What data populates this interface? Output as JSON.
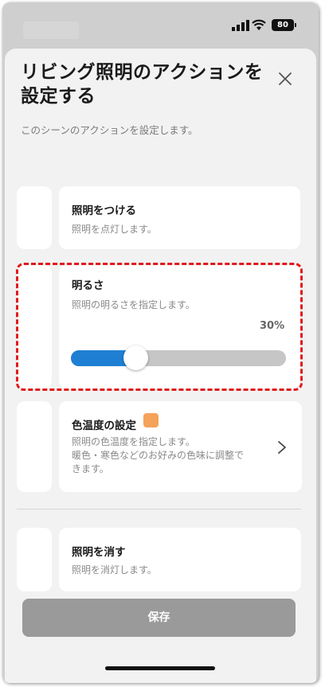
{
  "status_bar": {
    "battery": "80"
  },
  "sheet": {
    "title": "リビング照明のアクションを設定する",
    "subtitle": "このシーンのアクションを設定します。",
    "close_icon": "close-icon"
  },
  "actions": {
    "light_on": {
      "title": "照明をつける",
      "desc": "照明を点灯します。"
    },
    "brightness": {
      "title": "明るさ",
      "desc": "照明の明るさを指定します。",
      "value_label": "30%",
      "value": 0.3
    },
    "color_temp": {
      "title": "色温度の設定",
      "desc_line1": "照明の色温度を指定します。",
      "desc_line2": "暖色・寒色などのお好みの色味に調整で",
      "desc_line3": "きます。",
      "swatch_color": "#f5a25a"
    },
    "light_off": {
      "title": "照明を消す",
      "desc": "照明を消灯します。"
    }
  },
  "footer": {
    "save_label": "保存"
  },
  "colors": {
    "accent": "#1e7fd3",
    "highlight": "#e01a1a",
    "disabled_button": "#9a9a9a"
  }
}
